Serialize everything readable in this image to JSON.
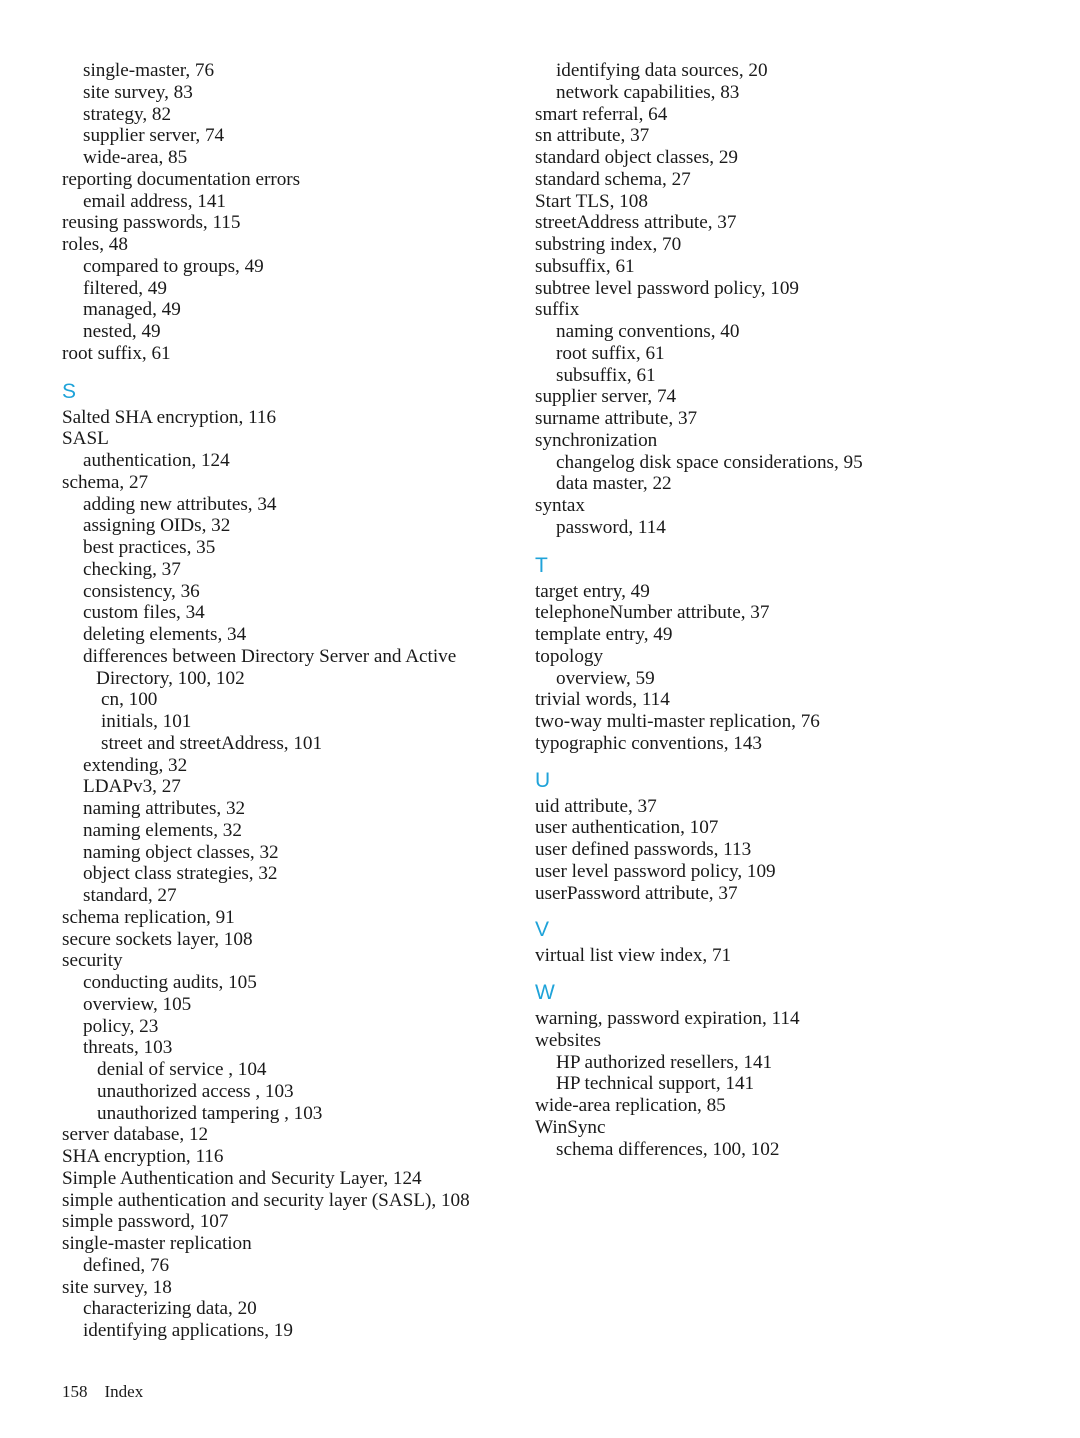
{
  "page": {
    "number": "158",
    "label": "Index",
    "footer_text": "158    Index",
    "heading_color": "#1fa3d9"
  },
  "columns": [
    {
      "id": "left",
      "blocks": [
        {
          "type": "entries",
          "items": [
            {
              "level": 1,
              "text": "single-master, 76"
            },
            {
              "level": 1,
              "text": "site survey, 83"
            },
            {
              "level": 1,
              "text": "strategy, 82"
            },
            {
              "level": 1,
              "text": "supplier server, 74"
            },
            {
              "level": 1,
              "text": "wide-area, 85"
            },
            {
              "level": 0,
              "text": "reporting documentation errors"
            },
            {
              "level": 1,
              "text": "email address, 141"
            },
            {
              "level": 0,
              "text": "reusing passwords, 115"
            },
            {
              "level": 0,
              "text": "roles, 48"
            },
            {
              "level": 1,
              "text": "compared to groups, 49"
            },
            {
              "level": 1,
              "text": "filtered, 49"
            },
            {
              "level": 1,
              "text": "managed, 49"
            },
            {
              "level": 1,
              "text": "nested, 49"
            },
            {
              "level": 0,
              "text": "root suffix, 61"
            }
          ]
        },
        {
          "type": "letter",
          "letter": "S"
        },
        {
          "type": "entries",
          "items": [
            {
              "level": 0,
              "text": "Salted SHA encryption, 116"
            },
            {
              "level": 0,
              "text": "SASL"
            },
            {
              "level": 1,
              "text": "authentication, 124"
            },
            {
              "level": 0,
              "text": "schema, 27"
            },
            {
              "level": 1,
              "text": "adding new attributes, 34"
            },
            {
              "level": 1,
              "text": "assigning OIDs, 32"
            },
            {
              "level": 1,
              "text": "best practices, 35"
            },
            {
              "level": 1,
              "text": "checking, 37"
            },
            {
              "level": 1,
              "text": "consistency, 36"
            },
            {
              "level": 1,
              "text": "custom files, 34"
            },
            {
              "level": 1,
              "text": "deleting elements, 34"
            },
            {
              "level": 1,
              "wrapped": true,
              "text": "differences between Directory Server and Active Directory, 100, 102"
            },
            {
              "level": 3,
              "text": "cn, 100"
            },
            {
              "level": 3,
              "text": "initials, 101"
            },
            {
              "level": 3,
              "text": "street and streetAddress, 101"
            },
            {
              "level": 1,
              "text": "extending, 32"
            },
            {
              "level": 1,
              "text": "LDAPv3, 27"
            },
            {
              "level": 1,
              "text": "naming attributes, 32"
            },
            {
              "level": 1,
              "text": "naming elements, 32"
            },
            {
              "level": 1,
              "text": "naming object classes, 32"
            },
            {
              "level": 1,
              "text": "object class strategies, 32"
            },
            {
              "level": 1,
              "text": "standard, 27"
            },
            {
              "level": 0,
              "text": "schema replication, 91"
            },
            {
              "level": 0,
              "text": "secure sockets layer, 108"
            },
            {
              "level": 0,
              "text": "security"
            },
            {
              "level": 1,
              "text": "conducting audits, 105"
            },
            {
              "level": 1,
              "text": "overview, 105"
            },
            {
              "level": 1,
              "text": "policy, 23"
            },
            {
              "level": 1,
              "text": "threats, 103"
            },
            {
              "level": 2,
              "text": "denial of service , 104"
            },
            {
              "level": 2,
              "text": "unauthorized access , 103"
            },
            {
              "level": 2,
              "text": "unauthorized tampering , 103"
            },
            {
              "level": 0,
              "text": "server database, 12"
            },
            {
              "level": 0,
              "text": "SHA encryption, 116"
            },
            {
              "level": 0,
              "text": "Simple Authentication and Security Layer, 124"
            },
            {
              "level": 0,
              "text": "simple authentication and security layer (SASL), 108"
            },
            {
              "level": 0,
              "text": "simple password, 107"
            },
            {
              "level": 0,
              "text": "single-master replication"
            },
            {
              "level": 1,
              "text": "defined, 76"
            },
            {
              "level": 0,
              "text": "site survey, 18"
            },
            {
              "level": 1,
              "text": "characterizing data, 20"
            },
            {
              "level": 1,
              "text": "identifying applications, 19"
            }
          ]
        }
      ]
    },
    {
      "id": "right",
      "blocks": [
        {
          "type": "entries",
          "items": [
            {
              "level": 1,
              "text": "identifying data sources, 20"
            },
            {
              "level": 1,
              "text": "network capabilities, 83"
            },
            {
              "level": 0,
              "text": "smart referral, 64"
            },
            {
              "level": 0,
              "text": "sn attribute, 37"
            },
            {
              "level": 0,
              "text": "standard object classes, 29"
            },
            {
              "level": 0,
              "text": "standard schema, 27"
            },
            {
              "level": 0,
              "text": "Start TLS, 108"
            },
            {
              "level": 0,
              "text": "streetAddress attribute, 37"
            },
            {
              "level": 0,
              "text": "substring index, 70"
            },
            {
              "level": 0,
              "text": "subsuffix, 61"
            },
            {
              "level": 0,
              "text": "subtree level password policy, 109"
            },
            {
              "level": 0,
              "text": "suffix"
            },
            {
              "level": 1,
              "text": "naming conventions, 40"
            },
            {
              "level": 1,
              "text": "root suffix, 61"
            },
            {
              "level": 1,
              "text": "subsuffix, 61"
            },
            {
              "level": 0,
              "text": "supplier server, 74"
            },
            {
              "level": 0,
              "text": "surname attribute, 37"
            },
            {
              "level": 0,
              "text": "synchronization"
            },
            {
              "level": 1,
              "text": "changelog disk space considerations, 95"
            },
            {
              "level": 1,
              "text": "data master, 22"
            },
            {
              "level": 0,
              "text": "syntax"
            },
            {
              "level": 1,
              "text": "password, 114"
            }
          ]
        },
        {
          "type": "letter",
          "letter": "T"
        },
        {
          "type": "entries",
          "items": [
            {
              "level": 0,
              "text": "target entry, 49"
            },
            {
              "level": 0,
              "text": "telephoneNumber attribute, 37"
            },
            {
              "level": 0,
              "text": "template entry, 49"
            },
            {
              "level": 0,
              "text": "topology"
            },
            {
              "level": 1,
              "text": "overview, 59"
            },
            {
              "level": 0,
              "text": "trivial words, 114"
            },
            {
              "level": 0,
              "text": "two-way multi-master replication, 76"
            },
            {
              "level": 0,
              "text": "typographic conventions, 143"
            }
          ]
        },
        {
          "type": "letter",
          "letter": "U"
        },
        {
          "type": "entries",
          "items": [
            {
              "level": 0,
              "text": "uid attribute, 37"
            },
            {
              "level": 0,
              "text": "user authentication, 107"
            },
            {
              "level": 0,
              "text": "user defined passwords, 113"
            },
            {
              "level": 0,
              "text": "user level password policy, 109"
            },
            {
              "level": 0,
              "text": "userPassword attribute, 37"
            }
          ]
        },
        {
          "type": "letter",
          "letter": "V"
        },
        {
          "type": "entries",
          "items": [
            {
              "level": 0,
              "text": "virtual list view index, 71"
            }
          ]
        },
        {
          "type": "letter",
          "letter": "W"
        },
        {
          "type": "entries",
          "items": [
            {
              "level": 0,
              "text": "warning, password expiration, 114"
            },
            {
              "level": 0,
              "text": "websites"
            },
            {
              "level": 1,
              "text": "HP authorized resellers, 141"
            },
            {
              "level": 1,
              "text": "HP technical support, 141"
            },
            {
              "level": 0,
              "text": "wide-area replication, 85"
            },
            {
              "level": 0,
              "text": "WinSync"
            },
            {
              "level": 1,
              "text": "schema differences, 100, 102"
            }
          ]
        }
      ]
    }
  ]
}
